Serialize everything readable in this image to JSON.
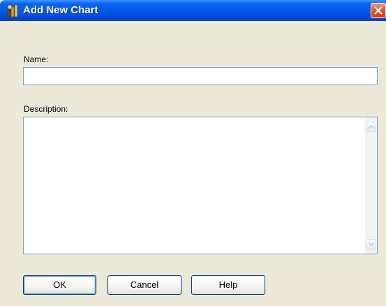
{
  "window": {
    "title": "Add New Chart",
    "icon": "chart-wizard-icon",
    "close_icon": "close-icon",
    "titlebar_color": "#0558e6",
    "close_color": "#e35a36"
  },
  "form": {
    "name_label": "Name:",
    "name_value": "",
    "description_label": "Description:",
    "description_value": ""
  },
  "buttons": {
    "ok": "OK",
    "cancel": "Cancel",
    "help": "Help"
  }
}
